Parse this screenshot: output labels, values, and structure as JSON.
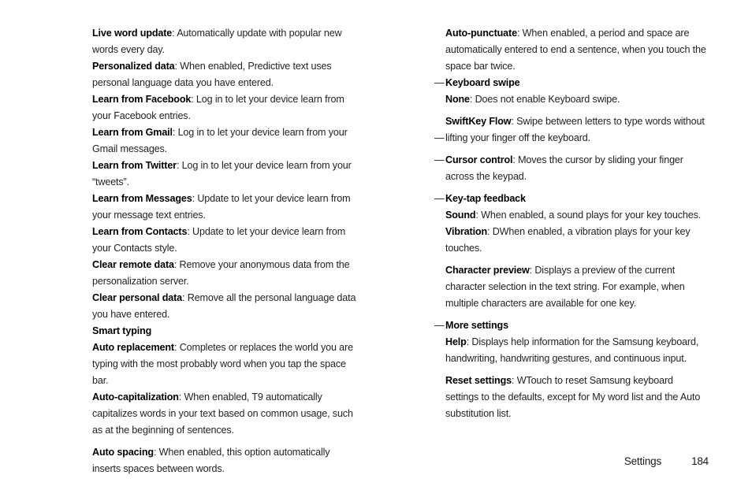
{
  "document": {
    "footer": {
      "section_label": "Settings",
      "page_number": "184"
    },
    "bullet_glyph": "—"
  },
  "left_column": {
    "items": [
      {
        "term": "Live word update",
        "separator": ": ",
        "description": "Automatically update with popular new words every day."
      },
      {
        "term": "Personalized data",
        "separator": ": ",
        "description": "When enabled, Predictive text uses personal language data you have entered."
      },
      {
        "term": "Learn from Facebook",
        "separator": ": ",
        "description": "Log in to let your device learn from your Facebook entries."
      },
      {
        "term": "Learn from Gmail",
        "separator": ": ",
        "description": "Log in to let your device learn from your Gmail messages."
      },
      {
        "term": "Learn from Twitter",
        "separator": ": ",
        "description": "Log in to let your device learn from your “tweets”."
      },
      {
        "term": "Learn from Messages",
        "separator": ": ",
        "description": "Update to let your device learn from your message text entries."
      },
      {
        "term": "Learn from Contacts",
        "separator": ": ",
        "description": "Update to let your device learn from your Contacts style."
      },
      {
        "term": "Clear remote data",
        "separator": ": ",
        "description": "Remove your anonymous data from the personalization server."
      },
      {
        "term": "Clear personal data",
        "separator": ": ",
        "description": "Remove all the personal language data you have entered."
      },
      {
        "term": "Smart typing",
        "separator": "",
        "description": ""
      },
      {
        "term": "Auto replacement",
        "separator": ": ",
        "description": "Completes or replaces the world you are typing with the most probably word when you tap the space bar."
      },
      {
        "term": "Auto-capitalization",
        "separator": ": ",
        "description": "When enabled, T9 automatically capitalizes words in your text based on common usage, such as at the beginning of sentences."
      },
      {
        "term": "Auto spacing",
        "separator": ": ",
        "description": "When enabled, this option automatically inserts spaces between words."
      }
    ]
  },
  "right_column": {
    "items": [
      {
        "term": "Auto-punctuate",
        "separator": ": ",
        "description": "When enabled, a period and space are automatically entered to end a sentence, when you touch the space bar twice."
      },
      {
        "term": "Keyboard swipe",
        "separator": "",
        "description": ""
      },
      {
        "term": "None",
        "separator": ": ",
        "description": "Does not enable Keyboard swipe."
      },
      {
        "term": "SwiftKey Flow",
        "separator": ": ",
        "description": "Swipe between letters to type words without"
      },
      {
        "term": "",
        "separator": "",
        "description": "lifting your finger off the keyboard."
      },
      {
        "term": "Cursor control",
        "separator": ": ",
        "description": "Moves the cursor by sliding your finger across the keypad."
      },
      {
        "term": "Key-tap feedback",
        "separator": "",
        "description": ""
      },
      {
        "term": "Sound",
        "separator": ": ",
        "description": "When enabled, a sound plays for your key touches."
      },
      {
        "term": "Vibration",
        "separator": ": ",
        "description": "DWhen enabled, a vibration plays for your key touches."
      },
      {
        "term": "Character preview",
        "separator": ": ",
        "description": "Displays a preview of the current character selection in the text string. For example, when multiple characters are available for one key."
      },
      {
        "term": "More settings",
        "separator": "",
        "description": ""
      },
      {
        "term": "Help",
        "separator": ": ",
        "description": "Displays help information for the Samsung keyboard, handwriting, handwriting gestures, and continuous input."
      },
      {
        "term": "Reset settings",
        "separator": ": ",
        "description": "WTouch to reset Samsung keyboard settings to the defaults, except for My word list and the Auto substitution list."
      }
    ]
  }
}
